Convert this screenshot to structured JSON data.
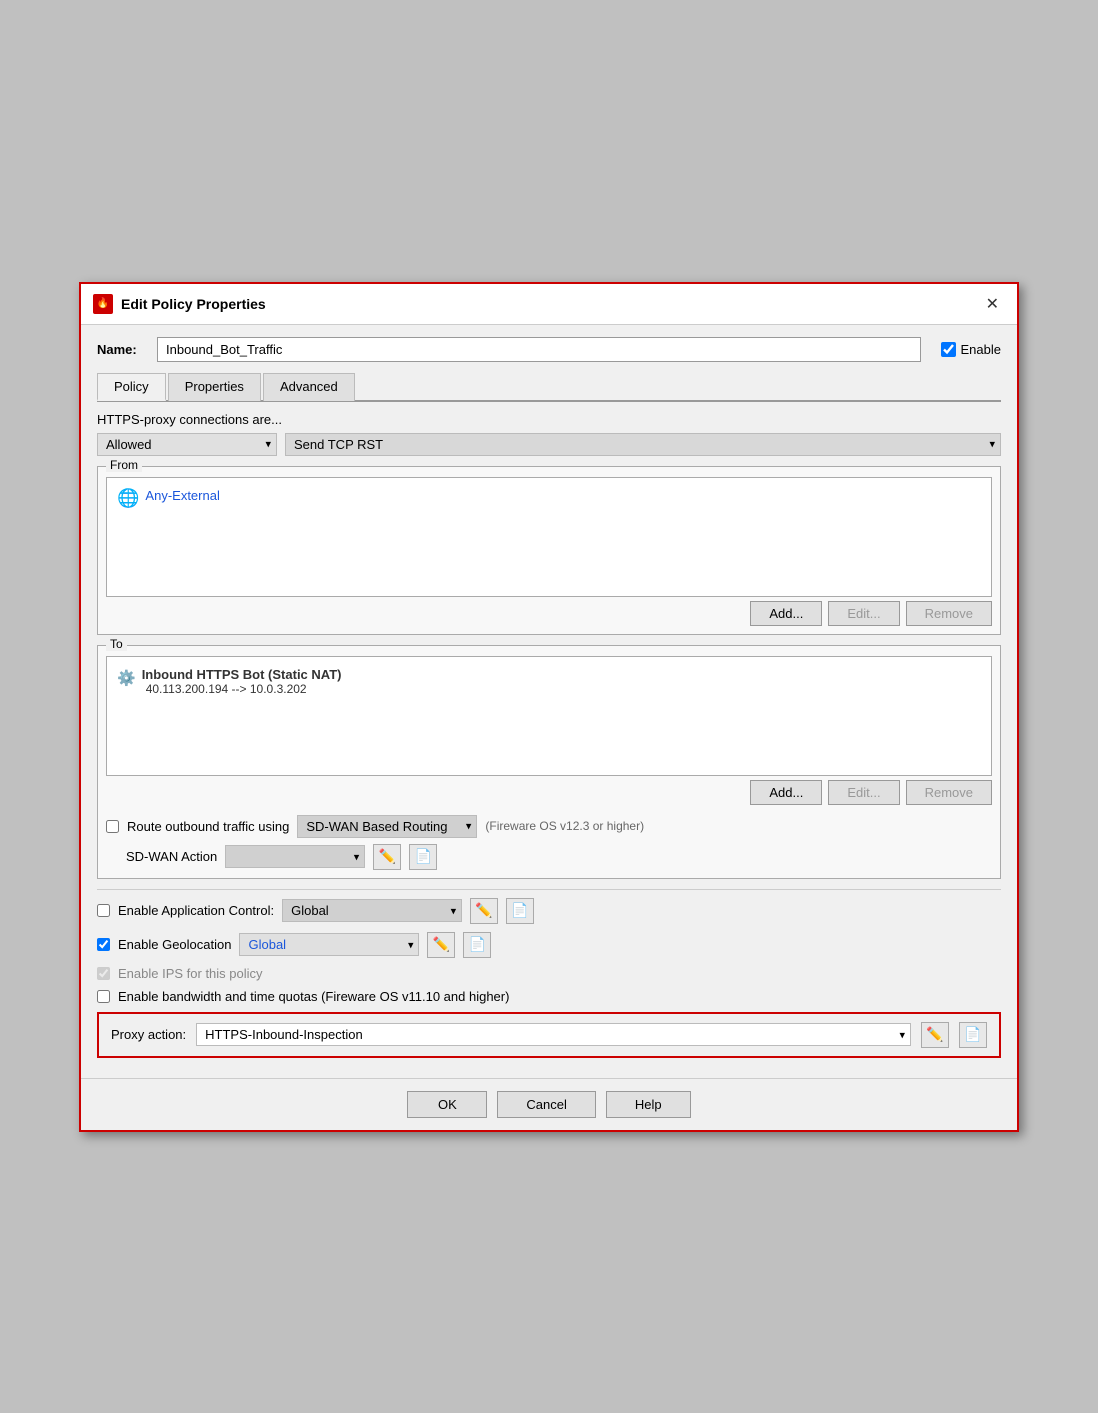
{
  "title": "Edit Policy Properties",
  "title_icon": "🔥",
  "name_label": "Name:",
  "name_value": "Inbound_Bot_Traffic",
  "enable_label": "Enable",
  "enable_checked": true,
  "tabs": [
    {
      "label": "Policy",
      "active": true
    },
    {
      "label": "Properties",
      "active": false
    },
    {
      "label": "Advanced",
      "active": false
    }
  ],
  "https_label": "HTTPS-proxy connections are...",
  "https_allowed": "Allowed",
  "https_action": "Send TCP RST",
  "from_label": "From",
  "from_items": [
    {
      "text": "Any-External"
    }
  ],
  "from_add": "Add...",
  "from_edit": "Edit...",
  "from_remove": "Remove",
  "to_label": "To",
  "to_items": [
    {
      "bold": "Inbound HTTPS Bot (Static NAT)",
      "secondary": "40.113.200.194 --> 10.0.3.202"
    }
  ],
  "to_add": "Add...",
  "to_edit": "Edit...",
  "to_remove": "Remove",
  "route_label": "Route outbound traffic using",
  "route_checked": false,
  "route_dropdown": "SD-WAN Based Routing",
  "route_note": "(Fireware OS v12.3 or higher)",
  "sdwan_action_label": "SD-WAN Action",
  "app_control_label": "Enable Application Control:",
  "app_control_checked": false,
  "app_control_dropdown": "Global",
  "geolocation_label": "Enable Geolocation",
  "geolocation_checked": true,
  "geolocation_dropdown": "Global",
  "ips_label": "Enable IPS for this policy",
  "ips_checked": true,
  "ips_disabled": true,
  "bandwidth_label": "Enable bandwidth and time quotas (Fireware OS v11.10 and higher)",
  "bandwidth_checked": false,
  "proxy_action_label": "Proxy action:",
  "proxy_action_value": "HTTPS-Inbound-Inspection",
  "ok_label": "OK",
  "cancel_label": "Cancel",
  "help_label": "Help"
}
